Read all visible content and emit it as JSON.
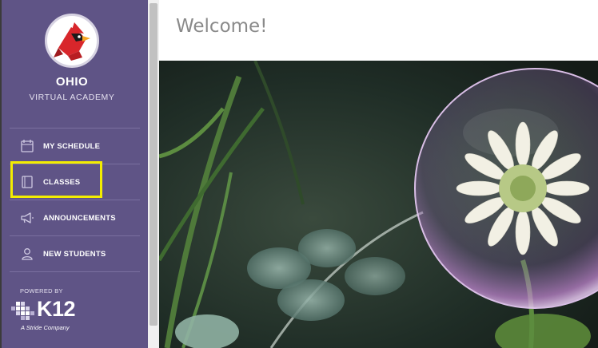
{
  "sidebar": {
    "school_name": "OHIO",
    "school_subtitle": "VIRTUAL ACADEMY",
    "items": [
      {
        "label": "MY SCHEDULE",
        "icon": "calendar-icon"
      },
      {
        "label": "CLASSES",
        "icon": "book-icon"
      },
      {
        "label": "ANNOUNCEMENTS",
        "icon": "megaphone-icon"
      },
      {
        "label": "NEW STUDENTS",
        "icon": "person-icon"
      }
    ],
    "powered_by": "POWERED BY",
    "brand": "K12",
    "brand_tagline": "A Stride Company"
  },
  "main": {
    "title": "Welcome!"
  },
  "colors": {
    "sidebar": "#5f5486",
    "highlight": "#f3ed00",
    "cardinal": "#d8262b"
  }
}
